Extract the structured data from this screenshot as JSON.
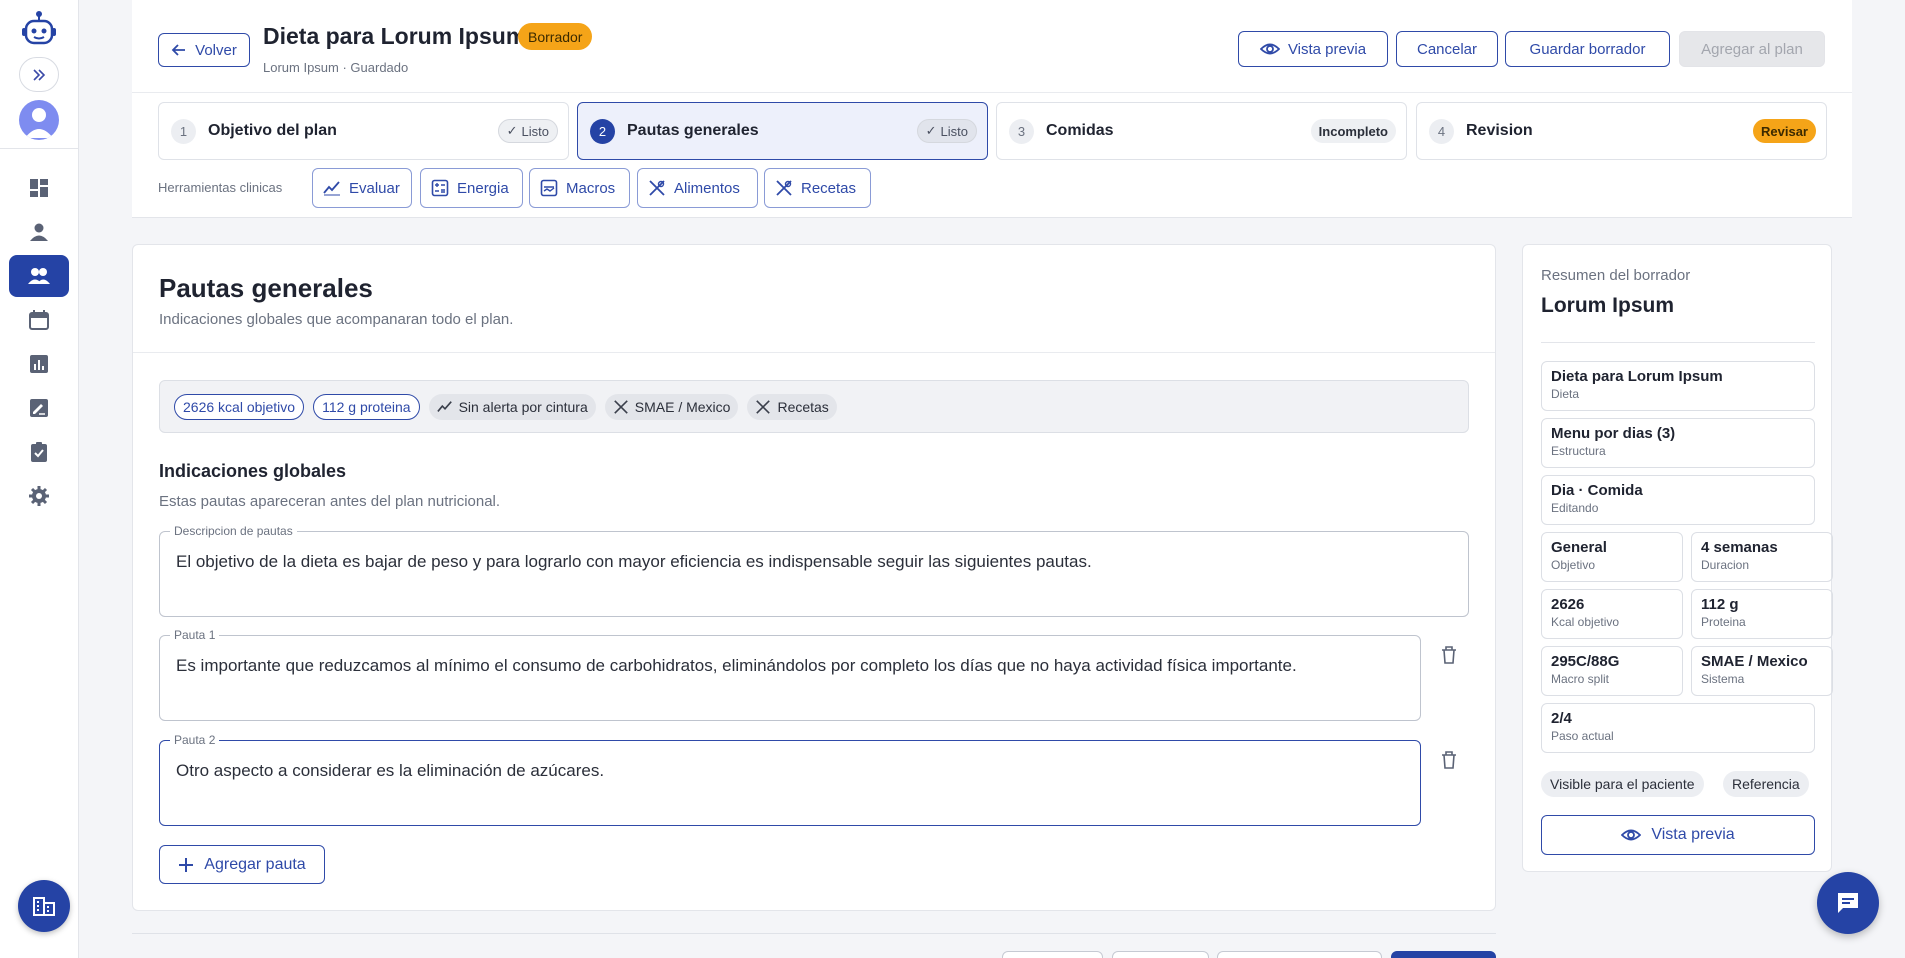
{
  "header": {
    "back_label": "Volver",
    "title": "Dieta para Lorum Ipsum",
    "status_badge": "Borrador",
    "subtitle": "Lorum Ipsum · Guardado",
    "preview_label": "Vista previa",
    "cancel_label": "Cancelar",
    "save_draft_label": "Guardar borrador",
    "add_to_plan_label": "Agregar al plan"
  },
  "steps": [
    {
      "num": "1",
      "label": "Objetivo del plan",
      "status": "Listo"
    },
    {
      "num": "2",
      "label": "Pautas generales",
      "status": "Listo"
    },
    {
      "num": "3",
      "label": "Comidas",
      "status": "Incompleto"
    },
    {
      "num": "4",
      "label": "Revision",
      "status": "Revisar"
    }
  ],
  "tools": {
    "label": "Herramientas clinicas",
    "items": [
      "Evaluar",
      "Energia",
      "Macros",
      "Alimentos",
      "Recetas"
    ]
  },
  "main": {
    "title": "Pautas generales",
    "subtitle": "Indicaciones globales que acompanaran todo el plan.",
    "chips": [
      "2626 kcal objetivo",
      "112 g proteina",
      "Sin alerta por cintura",
      "SMAE / Mexico",
      "Recetas"
    ],
    "section_title": "Indicaciones globales",
    "section_subtitle": "Estas pautas apareceran antes del plan nutricional.",
    "description": {
      "label": "Descripcion de pautas",
      "value": "El objetivo de la dieta es bajar de peso y para lograrlo con mayor eficiencia es indispensable seguir las siguientes pautas."
    },
    "pautas": [
      {
        "label": "Pauta 1",
        "value": "Es importante que reduzcamos al mínimo el consumo de carbohidratos, eliminándolos por completo los días que no haya actividad física importante."
      },
      {
        "label": "Pauta 2",
        "value": "Otro aspecto a considerar es la eliminación de azúcares."
      }
    ],
    "add_label": "Agregar pauta"
  },
  "summary": {
    "label": "Resumen del borrador",
    "name": "Lorum Ipsum",
    "cells": [
      {
        "value": "Dieta para Lorum Ipsum",
        "label": "Dieta"
      },
      {
        "value": "Menu por dias (3)",
        "label": "Estructura"
      },
      {
        "value": "Dia · Comida",
        "label": "Editando"
      },
      {
        "value": "General",
        "label": "Objetivo"
      },
      {
        "value": "4 semanas",
        "label": "Duracion"
      },
      {
        "value": "2626",
        "label": "Kcal objetivo"
      },
      {
        "value": "112 g",
        "label": "Proteina"
      },
      {
        "value": "295C/88G",
        "label": "Macro split"
      },
      {
        "value": "SMAE / Mexico",
        "label": "Sistema"
      },
      {
        "value": "2/4",
        "label": "Paso actual"
      }
    ],
    "tags": [
      "Visible para el paciente",
      "Referencia"
    ],
    "preview_label": "Vista previa"
  },
  "colors": {
    "primary": "#2543a5",
    "warning": "#f5a418",
    "background": "#f4f5f8"
  }
}
